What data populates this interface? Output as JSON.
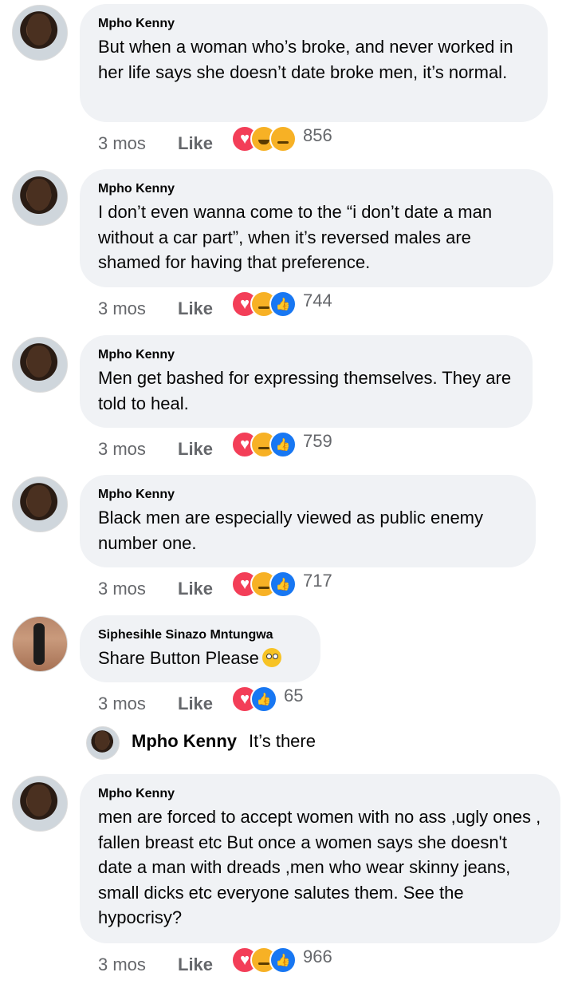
{
  "comments": [
    {
      "name": "Mpho Kenny",
      "text": "But when a woman who’s broke, and never worked in her life says she doesn’t date broke men, it’s normal.",
      "time": "3 mos",
      "like_label": "Like",
      "reactions": [
        "love-icon",
        "haha-icon",
        "sad-icon"
      ],
      "count": "856"
    },
    {
      "name": "Mpho Kenny",
      "text": "I don’t even wanna come to the “i don’t date a man without a car part”, when it’s reversed males are shamed for having that preference.",
      "time": "3 mos",
      "like_label": "Like",
      "reactions": [
        "love-icon",
        "sad-icon",
        "like-icon"
      ],
      "count": "744"
    },
    {
      "name": "Mpho Kenny",
      "text": "Men get bashed for expressing themselves. They are told to heal.",
      "time": "3 mos",
      "like_label": "Like",
      "reactions": [
        "love-icon",
        "sad-icon",
        "like-icon"
      ],
      "count": "759"
    },
    {
      "name": "Mpho Kenny",
      "text": "Black men are especially viewed as public enemy number one.",
      "time": "3 mos",
      "like_label": "Like",
      "reactions": [
        "love-icon",
        "sad-icon",
        "like-icon"
      ],
      "count": "717"
    },
    {
      "name": "Siphesihle Sinazo Mntungwa",
      "text": "Share Button Please",
      "emoji": "eye-roll-emoji",
      "time": "3 mos",
      "like_label": "Like",
      "reactions": [
        "love-icon",
        "like-icon"
      ],
      "count": "65"
    },
    {
      "name": "Mpho Kenny",
      "text": "men are forced to accept women with no ass ,ugly ones , fallen breast etc But once a women says she doesn't date a man with dreads ,men who wear skinny jeans, small dicks etc everyone salutes them. See the hypocrisy?",
      "time": "3 mos",
      "like_label": "Like",
      "reactions": [
        "love-icon",
        "sad-icon",
        "like-icon"
      ],
      "count": "966"
    }
  ],
  "reply": {
    "name": "Mpho Kenny",
    "text": "It’s there"
  },
  "colors": {
    "bubble": "#f0f2f5",
    "meta": "#65676b",
    "love": "#f33e58",
    "haha": "#f7b125",
    "like": "#1877f2"
  }
}
